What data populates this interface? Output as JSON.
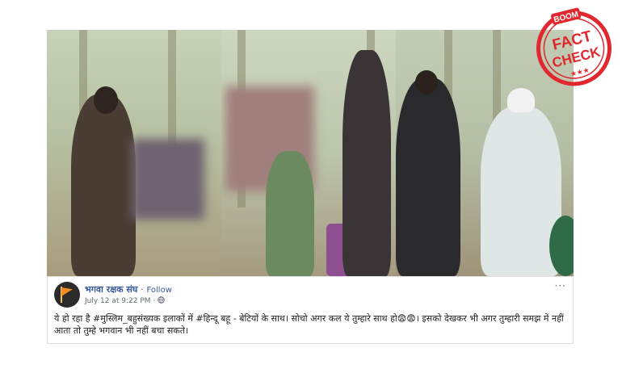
{
  "post": {
    "page_name": "भगवा रक्षक संघ",
    "separator": "·",
    "follow_label": "Follow",
    "timestamp": "July 12 at 9:22 PM",
    "meta_sep": "·",
    "privacy_icon": "globe-icon",
    "more_label": "···",
    "body_text": "ये हो रहा है #मुस्लिम_बहुसंख्यक इलाकों में #हिन्दू बहू - बेटियों के साथ। सोचो अगर कल ये तुम्हारे साथ हो😨😨। इसको देखकर भी अगर तुम्हारी समझ में नहीं आता तो तुम्हे भगवान भी नहीं बचा सकते।"
  },
  "stamp": {
    "brand": "BOOM",
    "line1": "FACT",
    "line2": "CHECK",
    "color": "#e0282e"
  }
}
